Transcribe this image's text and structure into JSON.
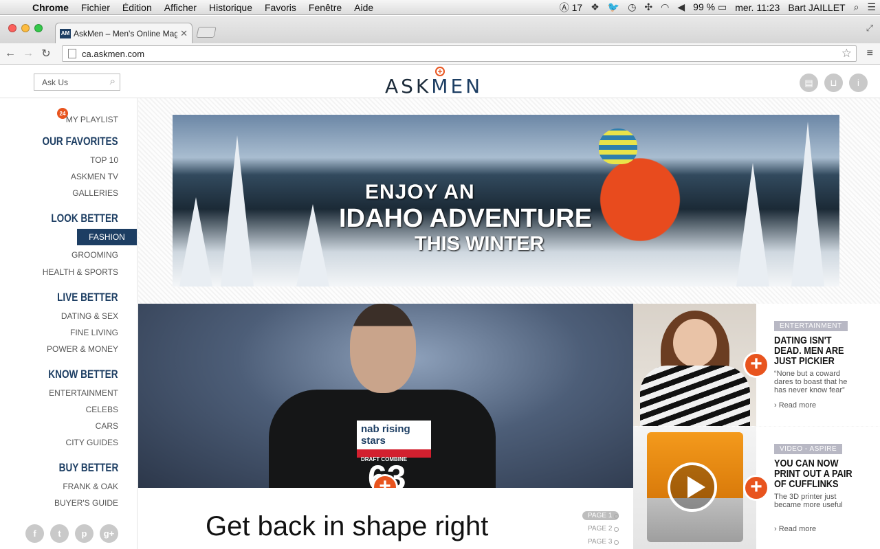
{
  "menubar": {
    "apple": "",
    "items": [
      "Chrome",
      "Fichier",
      "Édition",
      "Afficher",
      "Historique",
      "Favoris",
      "Fenêtre",
      "Aide"
    ],
    "adobe_count": "17",
    "battery": "99 %",
    "clock": "mer. 11:23",
    "user": "Bart JAILLET"
  },
  "browser": {
    "tab_title": "AskMen – Men's Online Maga",
    "favicon_text": "AM",
    "url": "ca.askmen.com"
  },
  "header": {
    "search_placeholder": "Ask Us",
    "logo_ask": "ASK",
    "logo_men": "MEN"
  },
  "sidebar": {
    "playlist_count": "24",
    "playlist_label": "MY PLAYLIST",
    "sections": [
      {
        "title": "OUR FAVORITES",
        "items": [
          "TOP 10",
          "ASKMEN TV",
          "GALLERIES"
        ]
      },
      {
        "title": "LOOK BETTER",
        "items": [
          "FASHION",
          "GROOMING",
          "HEALTH & SPORTS"
        ]
      },
      {
        "title": "LIVE BETTER",
        "items": [
          "DATING & SEX",
          "FINE LIVING",
          "POWER & MONEY"
        ]
      },
      {
        "title": "KNOW BETTER",
        "items": [
          "ENTERTAINMENT",
          "CELEBS",
          "CARS",
          "CITY GUIDES"
        ]
      },
      {
        "title": "BUY BETTER",
        "items": [
          "FRANK & OAK",
          "BUYER'S GUIDE"
        ]
      }
    ],
    "active_item": "FASHION",
    "social_icons": [
      "facebook-icon",
      "twitter-icon",
      "pinterest-icon",
      "google-plus-icon"
    ]
  },
  "banner": {
    "line1": "ENJOY AN",
    "line2": "IDAHO ADVENTURE",
    "line3": "THIS WINTER"
  },
  "feature": {
    "shirt_brand": "nab rising stars",
    "shirt_sub": "DRAFT COMBINE",
    "number": "63",
    "headline": "Get back in shape right",
    "pages": [
      "PAGE 1",
      "PAGE 2",
      "PAGE 3"
    ]
  },
  "cards": [
    {
      "category": "ENTERTAINMENT",
      "title": "DATING ISN'T DEAD. MEN ARE JUST PICKIER",
      "description": "“None but a coward dares to boast that he has never know fear”",
      "more": "Read more"
    },
    {
      "category": "VIDEO - ASPIRE",
      "title": "YOU CAN NOW PRINT OUT A PAIR OF CUFFLINKS",
      "description": "The 3D printer just became more useful",
      "more": "Read more"
    }
  ],
  "colors": {
    "brand_navy": "#1d3e63",
    "accent_orange": "#e8541e"
  }
}
